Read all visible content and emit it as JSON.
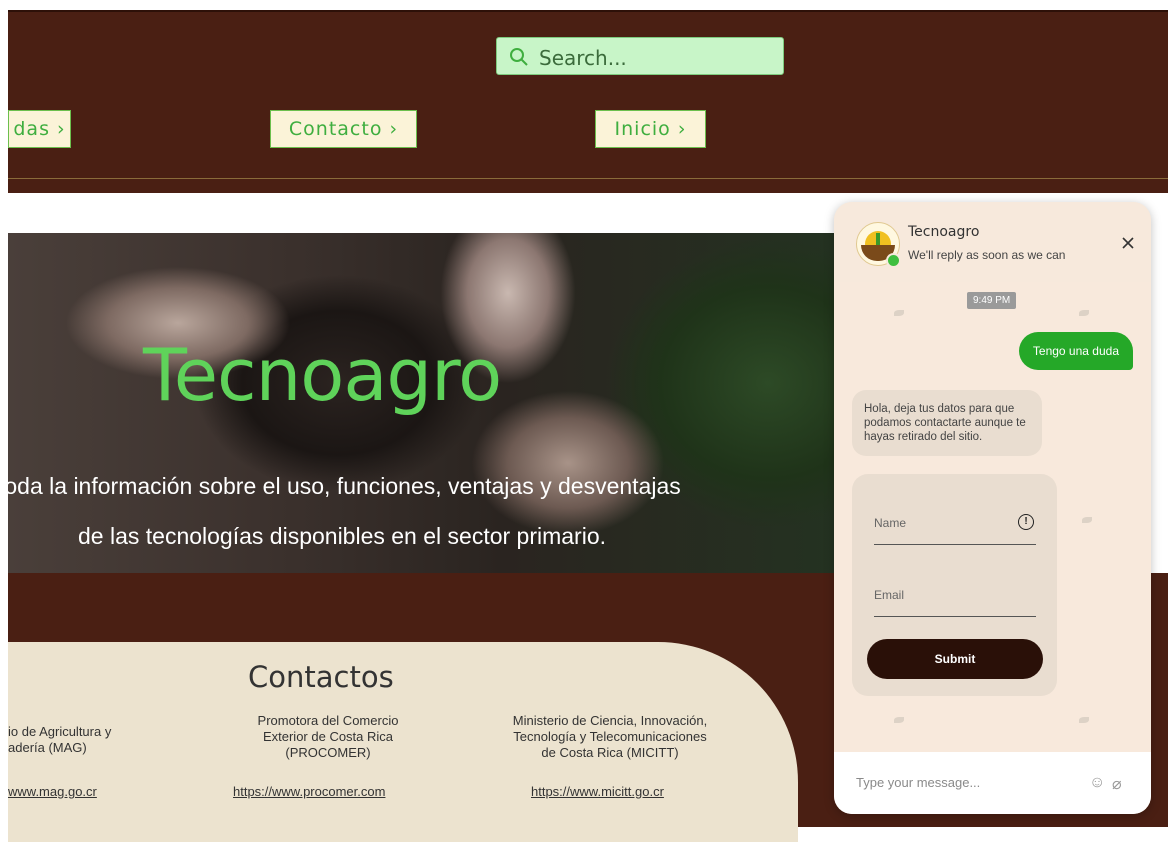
{
  "header": {
    "search_placeholder": "Search...",
    "nav": [
      {
        "label": "das ›"
      },
      {
        "label": "Contacto ›"
      },
      {
        "label": "Inicio ›"
      }
    ]
  },
  "hero": {
    "title": "Tecnoagro",
    "line1": "toda la información sobre el uso, funciones, ventajas y desventajas",
    "line2": "de las tecnologías disponibles en el sector primario."
  },
  "contacts": {
    "title": "Contactos",
    "orgs": [
      {
        "name_line1": "io de Agricultura y",
        "name_line2": "adería (MAG)",
        "link": "www.mag.go.cr"
      },
      {
        "name_line1": "Promotora del Comercio",
        "name_line2": "Exterior de Costa Rica",
        "name_line3": "(PROCOMER)",
        "link": "https://www.procomer.com"
      },
      {
        "name_line1": "Ministerio de Ciencia, Innovación,",
        "name_line2": "Tecnología y Telecomunicaciones",
        "name_line3": "de Costa Rica (MICITT)",
        "link": "https://www.micitt.go.cr"
      }
    ]
  },
  "chat": {
    "name": "Tecnoagro",
    "subtitle": "We'll reply as soon as we can",
    "time": "9:49 PM",
    "outgoing": "Tengo una duda",
    "incoming": "Hola, deja tus datos para que podamos contactarte aunque te hayas retirado del sitio.",
    "name_placeholder": "Name",
    "email_placeholder": "Email",
    "submit_label": "Submit",
    "message_placeholder": "Type your message...",
    "info_glyph": "!",
    "emoji_glyph": "☺",
    "attach_glyph": "⌀"
  },
  "colors": {
    "header_bg": "#4a1f13",
    "accent_green": "#5fd35a",
    "chat_bg": "#f7e9dc",
    "submit_bg": "#2a1008"
  }
}
